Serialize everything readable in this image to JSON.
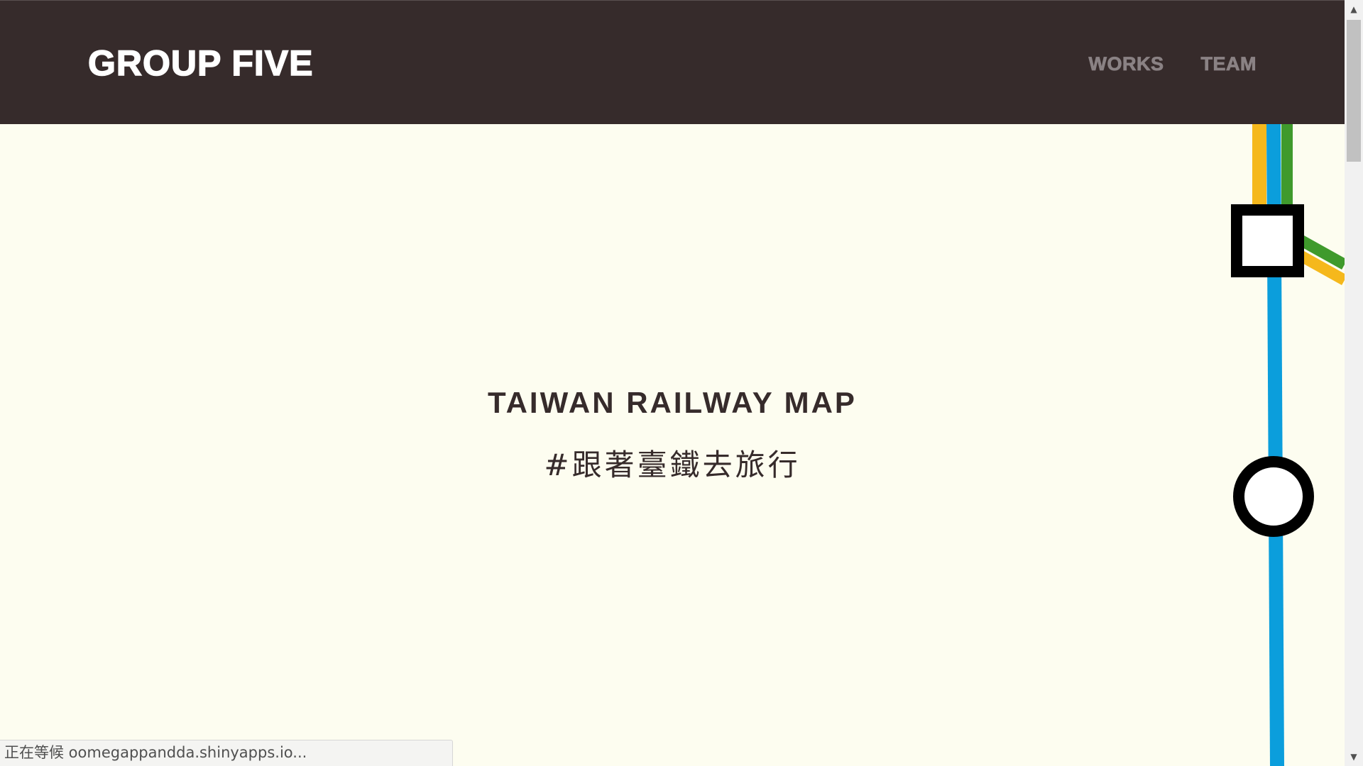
{
  "navbar": {
    "brand": "GROUP FIVE",
    "links": [
      {
        "label": "WORKS"
      },
      {
        "label": "TEAM"
      }
    ]
  },
  "hero": {
    "title": "TAIWAN RAILWAY MAP",
    "subtitle": "#跟著臺鐵去旅行"
  },
  "status_bar": {
    "text": "正在等候 oomegappandda.shinyapps.io..."
  },
  "colors": {
    "navbar_bg": "#362b2b",
    "page_bg": "#fdfdf0",
    "line_yellow": "#f5b81c",
    "line_blue": "#0b9edc",
    "line_green": "#3f9a2c",
    "station_stroke": "#000000",
    "station_fill": "#ffffff"
  }
}
